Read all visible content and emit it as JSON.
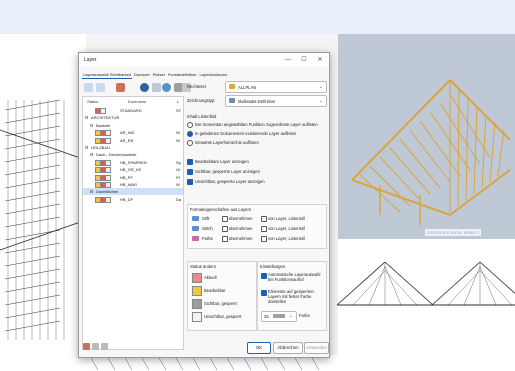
{
  "dialog": {
    "title": "Layer",
    "tabs": [
      "Layerauswahl/ Sichtbarkeit",
      "Druckset",
      "Plotset",
      "Formatdefinition",
      "Layerstrukturen"
    ],
    "active_tab": 0,
    "tree": {
      "headers": [
        "Status",
        "Kurzname",
        "L"
      ],
      "rows": [
        {
          "label": "STANDARD",
          "extra": "ST",
          "level": 2,
          "colors": [
            "#e05a52",
            "#f1f1f1"
          ],
          "selected": false
        },
        {
          "label": "ARCHITEKTUR",
          "extra": "",
          "level": 0,
          "colors": [],
          "selected": false
        },
        {
          "label": "Bauteile",
          "extra": "",
          "level": 1,
          "colors": [],
          "selected": false
        },
        {
          "label": "AR_WD",
          "extra": "W",
          "level": 2,
          "colors": [
            "#f1c640",
            "#e05a52",
            "#f1f1f1"
          ],
          "selected": false
        },
        {
          "label": "AR_EB",
          "extra": "W",
          "level": 2,
          "colors": [
            "#f1c640",
            "#e05a52",
            "#f1f1f1"
          ],
          "selected": false
        },
        {
          "label": "HOLZBAU",
          "extra": "",
          "level": 0,
          "colors": [],
          "selected": false
        },
        {
          "label": "Dach-, Deckenbauteile",
          "extra": "",
          "level": 1,
          "colors": [],
          "selected": false
        },
        {
          "label": "HB_SPARREN",
          "extra": "Sp",
          "level": 2,
          "colors": [
            "#f1c640",
            "#e05a52",
            "#f1f1f1"
          ],
          "selected": false
        },
        {
          "label": "HB_GR_KE",
          "extra": "Gr",
          "level": 2,
          "colors": [
            "#f1c640",
            "#e05a52",
            "#f1f1f1"
          ],
          "selected": false
        },
        {
          "label": "HB_PF",
          "extra": "Pf",
          "level": 2,
          "colors": [
            "#f1c640",
            "#e05a52",
            "#f1f1f1"
          ],
          "selected": false
        },
        {
          "label": "HB_WAR",
          "extra": "W",
          "level": 2,
          "colors": [
            "#f1c640",
            "#e05a52",
            "#f1f1f1"
          ],
          "selected": false
        },
        {
          "label": "Dachflächen",
          "extra": "",
          "level": 1,
          "colors": [],
          "selected": true
        },
        {
          "label": "HB_DF",
          "extra": "Da",
          "level": 2,
          "colors": [
            "#f1c640",
            "#e05a52",
            "#f1f1f1"
          ],
          "selected": false
        }
      ]
    },
    "rechteset_label": "Rechteset",
    "rechteset_value": "ALLPLAN",
    "zeichnungstyp_label": "Zeichnungstyp:",
    "zeichnungstyp_value": "Maßstabs-Definition",
    "inhalt_label": "Inhalt Listenfeld",
    "radio_options": [
      {
        "label": "Der momentan angewählten Funktion zugeordnete Layer auflisten",
        "on": false
      },
      {
        "label": "In geladenen Dokumenten existierende Layer auflisten",
        "on": true
      },
      {
        "label": "Gesamte Layerhierarchie auflisten",
        "on": false
      }
    ],
    "check_options": [
      {
        "label": "Bearbeitbare Layer anzeigen",
        "on": true
      },
      {
        "label": "Sichtbar, gesperrte Layer anzeigen",
        "on": true
      },
      {
        "label": "Unsichtbar, gesperrte Layer anzeigen",
        "on": true
      }
    ],
    "format_label": "Formateigenschaften aus Layern",
    "format_rows": [
      {
        "name": "Stift",
        "take": "übernehmen",
        "from": "von Layer, Linienstil"
      },
      {
        "name": "Strich",
        "take": "übernehmen",
        "from": "von Layer, Linienstil"
      },
      {
        "name": "Farbe",
        "take": "übernehmen",
        "from": "von Layer, Linienstil"
      }
    ],
    "status_label": "Status ändern",
    "status_items": [
      {
        "label": "Aktuell",
        "color": "#e98a84"
      },
      {
        "label": "Bearbeitbar",
        "color": "#f1c640"
      },
      {
        "label": "Sichtbar, gesperrt",
        "color": "#9e9e9e"
      },
      {
        "label": "Unsichtbar, gesperrt",
        "color": "#f1f1f1"
      }
    ],
    "settings_label": "Einstellungen",
    "settings_check1": "Automatische Layerauswahl bei Funktionsaufruf",
    "settings_check2": "Elemente auf gesperrten Layern mit fester Farbe darstellen",
    "color_number": "25",
    "color_label": "Farbe",
    "ok_label": "OK",
    "cancel_label": "Abbrechen",
    "apply_label": "Anwenden"
  },
  "viewport": {
    "label": "Ansicht von vorne, Seiten 1"
  },
  "colors": {
    "accent": "#1a5fb4",
    "viewport_bg": "#bfc9d6",
    "timber": "#d9a441"
  }
}
